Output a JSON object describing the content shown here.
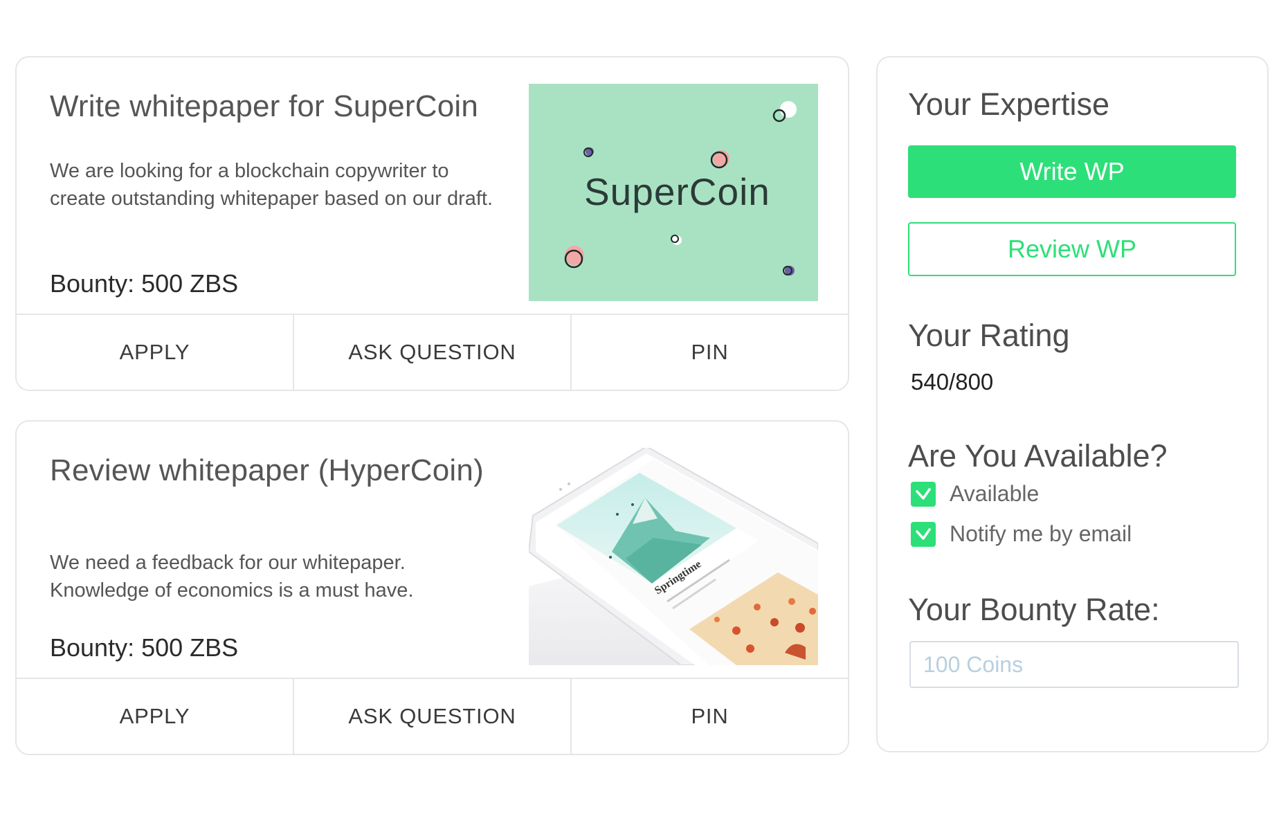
{
  "jobs": [
    {
      "title": "Write whitepaper for SuperCoin",
      "description": "We are looking for a blockchain copywriter to create outstanding whitepaper based on our draft.",
      "bounty": "Bounty: 500 ZBS",
      "image_text": "SuperCoin",
      "actions": {
        "apply": "APPLY",
        "ask": "ASK QUESTION",
        "pin": "PIN"
      }
    },
    {
      "title": "Review whitepaper (HyperCoin)",
      "description": "We need a feedback for our whitepaper. Knowledge of economics is a must have.",
      "bounty": "Bounty: 500 ZBS",
      "image_text": "Springtime",
      "actions": {
        "apply": "APPLY",
        "ask": "ASK QUESTION",
        "pin": "PIN"
      }
    }
  ],
  "sidebar": {
    "expertise_heading": "Your Expertise",
    "write_wp_label": "Write WP",
    "review_wp_label": "Review WP",
    "rating_heading": "Your Rating",
    "rating_value": "540/800",
    "availability_heading": "Are You Available?",
    "available_label": "Available",
    "notify_label": "Notify me by email",
    "bounty_rate_heading": "Your Bounty Rate:",
    "bounty_rate_placeholder": "100 Coins"
  },
  "colors": {
    "accent": "#2ddf78",
    "supercoin_bg": "#a9e2c2",
    "border": "#e6e6e6"
  },
  "icons": {
    "checkbox": "check-icon"
  }
}
